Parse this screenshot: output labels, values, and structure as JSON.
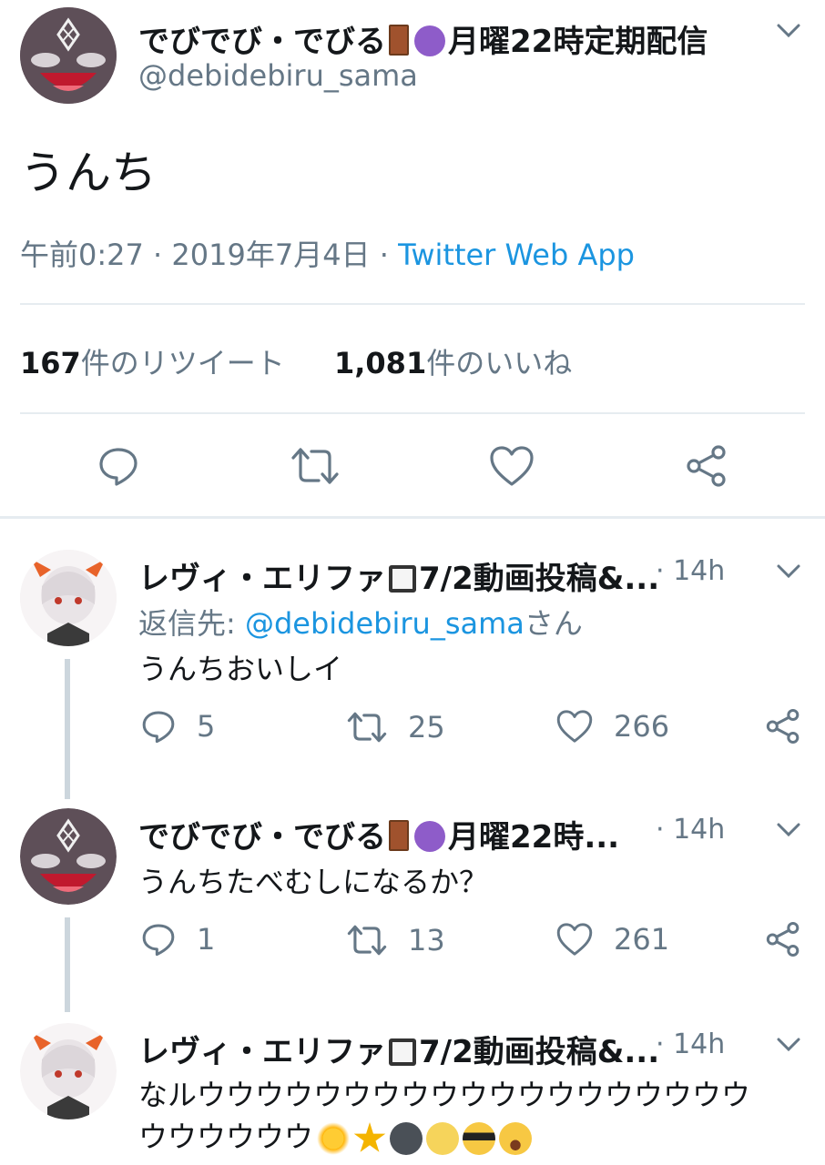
{
  "main_tweet": {
    "display_name": "でびでび・でびる",
    "name_suffix": "月曜22時定期配信",
    "handle": "@debidebiru_sama",
    "text": "うんち",
    "time": "午前0:27",
    "date": "2019年7月4日",
    "separator": "·",
    "source": "Twitter Web App",
    "retweet_count": "167",
    "retweet_label": "件のリツイート",
    "like_count": "1,081",
    "like_label": "件のいいね"
  },
  "replies": [
    {
      "display_name": "レヴィ・エリファ",
      "name_suffix": "7/2動画投稿&...",
      "time": "· 14h",
      "reply_prefix": "返信先: ",
      "reply_to": "@debidebiru_sama",
      "reply_suffix": "さん",
      "text": "うんちおいしイ",
      "reply_count": "5",
      "retweet_count": "25",
      "like_count": "266"
    },
    {
      "display_name": "でびでび・でびる",
      "name_suffix": "月曜22時...",
      "time": "· 14h",
      "text": "うんちたべむしになるか？",
      "reply_count": "1",
      "retweet_count": "13",
      "like_count": "261"
    },
    {
      "display_name": "レヴィ・エリファ",
      "name_suffix": "7/2動画投稿&...",
      "time": "· 14h",
      "text_line1": "なルウウウウウウウウウウウウウウウウウウウ",
      "text_line2": "ウウウウウウ"
    }
  ],
  "icons": [
    "chevron-down-icon",
    "reply-icon",
    "retweet-icon",
    "like-icon",
    "share-icon"
  ],
  "colors": {
    "link": "#1b95e0",
    "secondary_text": "#657786",
    "divider": "#e6ecf0",
    "thread_line": "#ccd6dd"
  }
}
